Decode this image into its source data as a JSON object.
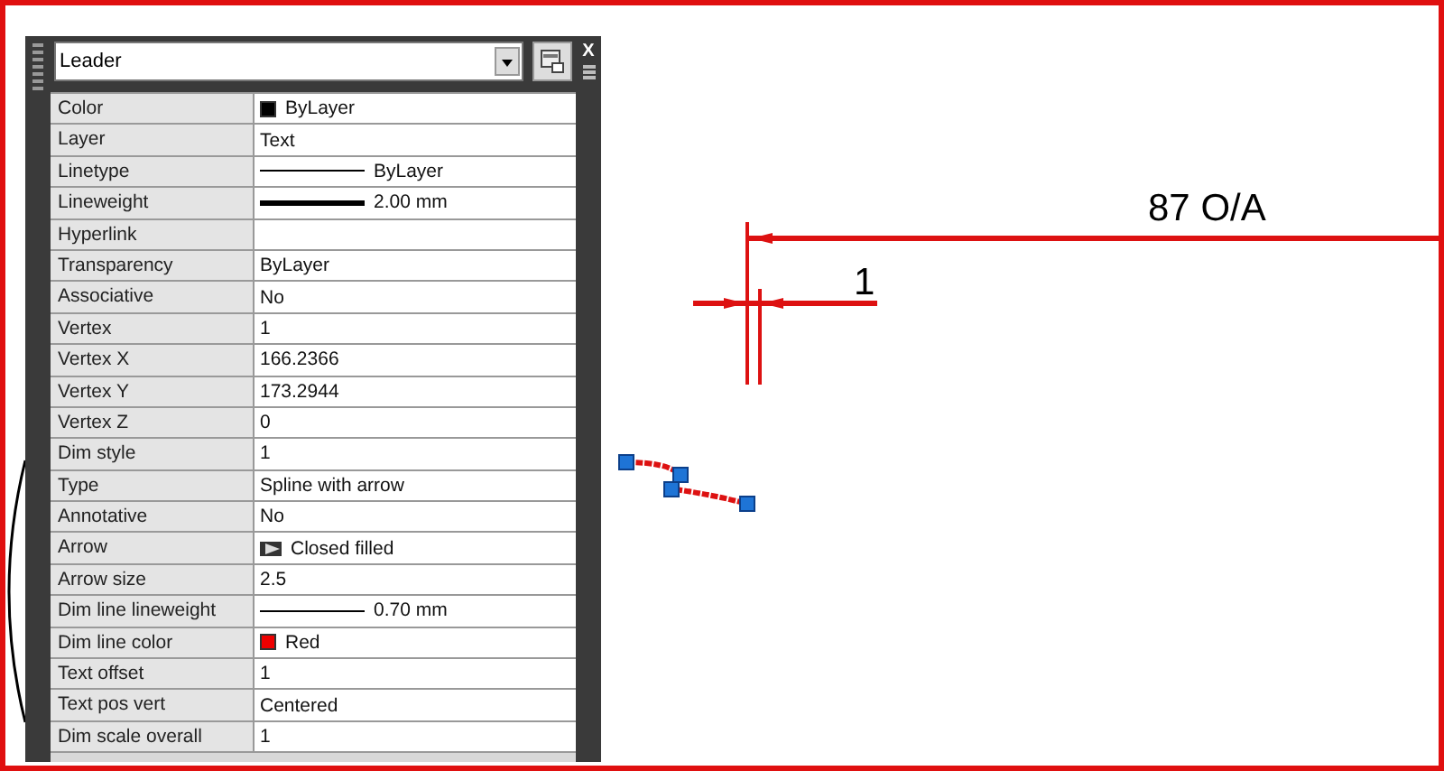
{
  "palette": {
    "selector": "Leader",
    "close": "X"
  },
  "properties": [
    {
      "label": "Color",
      "kind": "color",
      "color": "#000000",
      "value": "ByLayer"
    },
    {
      "label": "Layer",
      "kind": "text",
      "value": "Text"
    },
    {
      "label": "Linetype",
      "kind": "line",
      "value": "ByLayer"
    },
    {
      "label": "Lineweight",
      "kind": "heavyline",
      "value": "2.00 mm"
    },
    {
      "label": "Hyperlink",
      "kind": "text"
    },
    {
      "label": "Transparency",
      "kind": "text",
      "value": "ByLayer"
    },
    {
      "label": "Associative",
      "kind": "text",
      "value": "No"
    },
    {
      "label": "Vertex",
      "kind": "text",
      "value": "1"
    },
    {
      "label": "Vertex X",
      "kind": "text",
      "value": "166.2366"
    },
    {
      "label": "Vertex Y",
      "kind": "text",
      "value": "173.2944"
    },
    {
      "label": "Vertex Z",
      "kind": "text",
      "value": "0"
    },
    {
      "label": "Dim style",
      "kind": "text",
      "value": "1"
    },
    {
      "label": "Type",
      "kind": "text",
      "value": "Spline with arrow"
    },
    {
      "label": "Annotative",
      "kind": "text",
      "value": "No"
    },
    {
      "label": "Arrow",
      "kind": "arrow",
      "value": "Closed filled"
    },
    {
      "label": "Arrow size",
      "kind": "text",
      "value": "2.5"
    },
    {
      "label": "Dim line lineweight",
      "kind": "line",
      "value": "0.70 mm"
    },
    {
      "label": "Dim line color",
      "kind": "color",
      "color": "#ee0000",
      "value": "Red"
    },
    {
      "label": "Text offset",
      "kind": "text",
      "value": "1"
    },
    {
      "label": "Text pos vert",
      "kind": "text",
      "value": "Centered"
    },
    {
      "label": "Dim scale overall",
      "kind": "text",
      "value": "1"
    }
  ],
  "drawing": {
    "dimension_text": "87 O/A",
    "small_dimension_text": "1"
  }
}
